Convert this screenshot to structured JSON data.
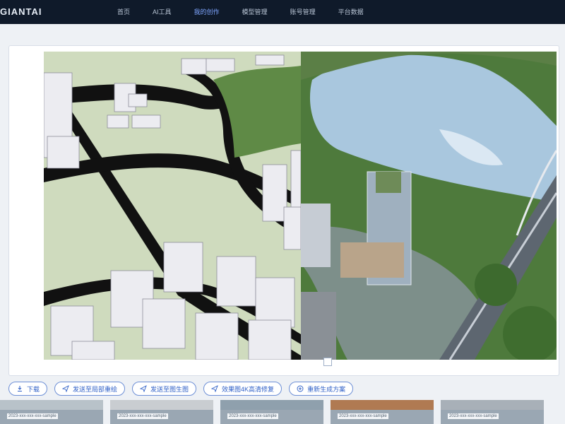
{
  "header": {
    "brand": "GIANTAI",
    "nav": [
      "首页",
      "AI工具",
      "我的创作",
      "模型管理",
      "账号管理",
      "平台数据"
    ],
    "active_index": 2
  },
  "toolbar": {
    "buttons": [
      {
        "label": "下载",
        "icon": "download-icon"
      },
      {
        "label": "发送至局部重绘",
        "icon": "send-icon"
      },
      {
        "label": "发送至图生图",
        "icon": "send-icon"
      },
      {
        "label": "效果图4K高清修复",
        "icon": "send-icon"
      },
      {
        "label": "重新生成方案",
        "icon": "plus-circle-icon"
      }
    ]
  },
  "thumbnails": [
    {
      "caption": "2023-xxx-xxx-xxx-sample"
    },
    {
      "caption": "2023-xxx-xxx-xxx-sample"
    },
    {
      "caption": "2023-xxx-xxx-xxx-sample"
    },
    {
      "caption": "2023-xxx-xxx-xxx-sample"
    },
    {
      "caption": "2023-xxx-xxx-xxx-sample"
    }
  ],
  "colors": {
    "topbar": "#0f1a2a",
    "accent": "#2e5fc7",
    "water": "#a9c7de",
    "grass": "#5f8a46",
    "model_ground": "#cfdbbe"
  }
}
